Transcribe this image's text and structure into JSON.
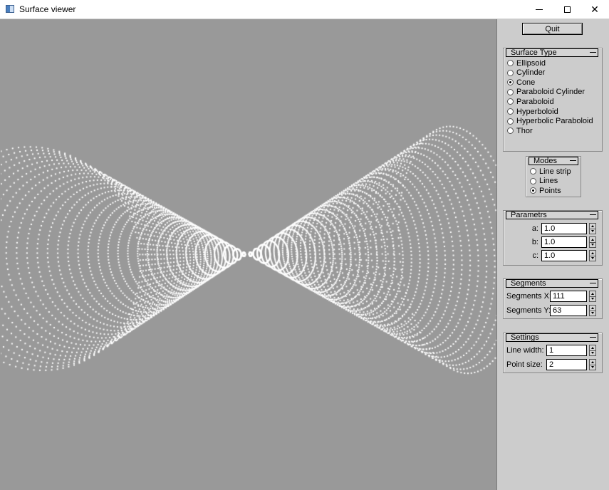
{
  "window": {
    "title": "Surface viewer"
  },
  "viewport": {
    "background": "#999999",
    "point_color": "#ffffff",
    "mode": "Points"
  },
  "panel": {
    "quit_label": "Quit",
    "surface_type": {
      "title": "Surface Type",
      "options": [
        "Ellipsoid",
        "Cylinder",
        "Cone",
        "Paraboloid Cylinder",
        "Paraboloid",
        "Hyperboloid",
        "Hyperbolic Paraboloid",
        "Thor"
      ],
      "selected": "Cone"
    },
    "modes": {
      "title": "Modes",
      "options": [
        "Line strip",
        "Lines",
        "Points"
      ],
      "selected": "Points"
    },
    "parameters": {
      "title": "Parametrs",
      "fields": [
        {
          "label": "a:",
          "value": "1.0"
        },
        {
          "label": "b:",
          "value": "1.0"
        },
        {
          "label": "c:",
          "value": "1.0"
        }
      ]
    },
    "segments": {
      "title": "Segments",
      "fields": [
        {
          "label": "Segments X:",
          "value": "111"
        },
        {
          "label": "Segments Y:",
          "value": "63"
        }
      ]
    },
    "settings": {
      "title": "Settings",
      "fields": [
        {
          "label": "Line width:",
          "value": "1"
        },
        {
          "label": "Point size:",
          "value": "2"
        }
      ]
    }
  }
}
